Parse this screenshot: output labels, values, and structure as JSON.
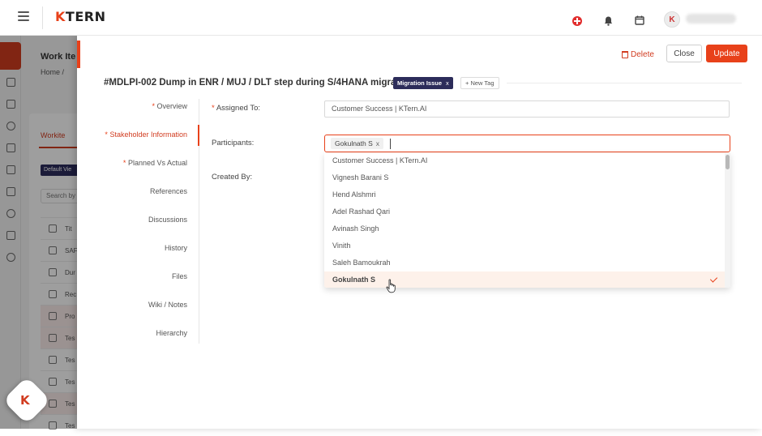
{
  "header": {
    "logo_k": "K",
    "logo_rest": "TERN",
    "icons": [
      "menu-icon",
      "add-icon",
      "bell-icon",
      "calendar-icon",
      "user-avatar"
    ],
    "avatar_letter": "K"
  },
  "background": {
    "page_title": "Work Ite",
    "breadcrumb": "Home  /",
    "tab": "Workite",
    "view_chip": "Default Vie",
    "search_placeholder": "Search by",
    "rows": [
      {
        "text": "Tit",
        "highlight": false
      },
      {
        "text": "SAF",
        "highlight": false
      },
      {
        "text": "Dur",
        "highlight": false
      },
      {
        "text": "Rec",
        "highlight": false
      },
      {
        "text": "Pro",
        "highlight": true
      },
      {
        "text": "Tes",
        "highlight": true
      },
      {
        "text": "Tes",
        "highlight": false
      },
      {
        "text": "Tes",
        "highlight": false
      },
      {
        "text": "Tes",
        "highlight": true
      },
      {
        "text": "Tes",
        "highlight": false
      }
    ],
    "fab_letter": "K"
  },
  "toolbar": {
    "delete_label": "Delete",
    "close_label": "Close",
    "update_label": "Update"
  },
  "work_item": {
    "title": "#MDLPI-002 Dump in ENR / MUJ / DLT step during S/4HANA migration",
    "tag": "Migration Issue",
    "tag_remove": "x",
    "new_tag_label": "+ New Tag"
  },
  "sections": [
    {
      "label": "Overview",
      "required": true,
      "active": false
    },
    {
      "label": "Stakeholder Information",
      "required": true,
      "active": true
    },
    {
      "label": "Planned Vs Actual",
      "required": true,
      "active": false
    },
    {
      "label": "References",
      "required": false,
      "active": false
    },
    {
      "label": "Discussions",
      "required": false,
      "active": false
    },
    {
      "label": "History",
      "required": false,
      "active": false
    },
    {
      "label": "Files",
      "required": false,
      "active": false
    },
    {
      "label": "Wiki / Notes",
      "required": false,
      "active": false
    },
    {
      "label": "Hierarchy",
      "required": false,
      "active": false
    }
  ],
  "form": {
    "assigned_to_label": "Assigned To:",
    "assigned_to_value": "Customer Success | KTern.AI",
    "participants_label": "Participants:",
    "participants_chip": "Gokulnath S",
    "chip_remove": "x",
    "created_by_label": "Created By:",
    "required_mark": "*"
  },
  "participants_dropdown": {
    "options": [
      "Customer Success | KTern.AI",
      "Vignesh Barani S",
      "Hend Alshmri",
      "Adel Rashad Qari",
      "Avinash Singh",
      "Vinith",
      "Saleh Bamoukrah",
      "Gokulnath S"
    ],
    "selected": "Gokulnath S"
  },
  "colors": {
    "accent": "#e8411a",
    "tag_bg": "#2c2c5a",
    "selected_row": "#fdf1ea"
  }
}
